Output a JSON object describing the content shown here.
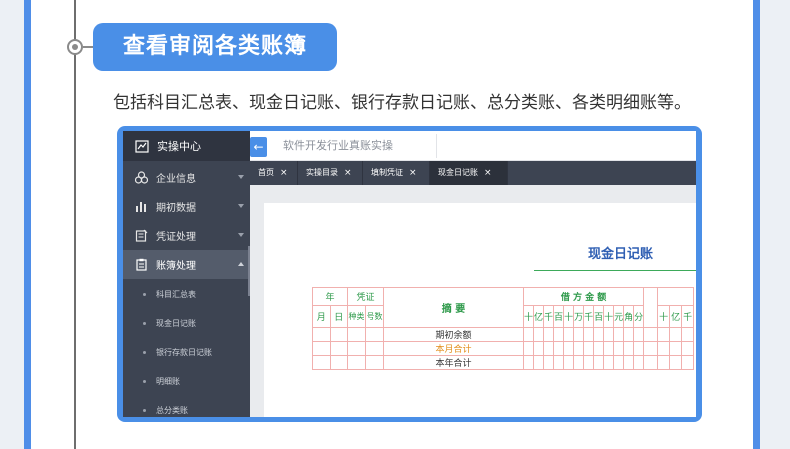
{
  "header": {
    "title": "查看审阅各类账簿",
    "description": "包括科目汇总表、现金日记账、银行存款日记账、总分类账、各类明细账等。"
  },
  "app": {
    "brand": "实操中心",
    "menu": [
      {
        "label": "企业信息",
        "icon": "company-icon"
      },
      {
        "label": "期初数据",
        "icon": "chart-icon"
      },
      {
        "label": "凭证处理",
        "icon": "voucher-icon"
      },
      {
        "label": "账簿处理",
        "icon": "ledger-icon",
        "active": true
      }
    ],
    "submenu": [
      "科目汇总表",
      "现金日记账",
      "银行存款日记账",
      "明细账",
      "总分类账"
    ],
    "search_placeholder": "软件开发行业真账实操",
    "collapse_icon": "arrow-left-icon",
    "tabs": [
      {
        "label": "首页"
      },
      {
        "label": "实操目录"
      },
      {
        "label": "填制凭证"
      },
      {
        "label": "现金日记账",
        "active": true
      }
    ],
    "tab_close": "×"
  },
  "ledger": {
    "title": "现金日记账",
    "year_label": "年",
    "voucher_label": "凭证",
    "month_label": "月",
    "day_label": "日",
    "type_label": "种类",
    "number_label": "号数",
    "summary_label": "摘 要",
    "debit_label": "借 方 金 额",
    "digits": [
      "十",
      "亿",
      "千",
      "百",
      "十",
      "万",
      "千",
      "百",
      "十",
      "元",
      "角",
      "分"
    ],
    "partial_digits": [
      "十",
      "亿",
      "千"
    ],
    "rows": [
      {
        "summary": "期初余额",
        "highlight": false
      },
      {
        "summary": "本月合计",
        "highlight": true
      },
      {
        "summary": "本年合计",
        "highlight": false
      }
    ]
  },
  "colors": {
    "accent": "#4a8fe7",
    "sidebar": "#3d4452",
    "ledger_green": "#2f9a4b",
    "ledger_red_border": "#f1b0ae",
    "highlight_orange": "#e38e1c"
  }
}
